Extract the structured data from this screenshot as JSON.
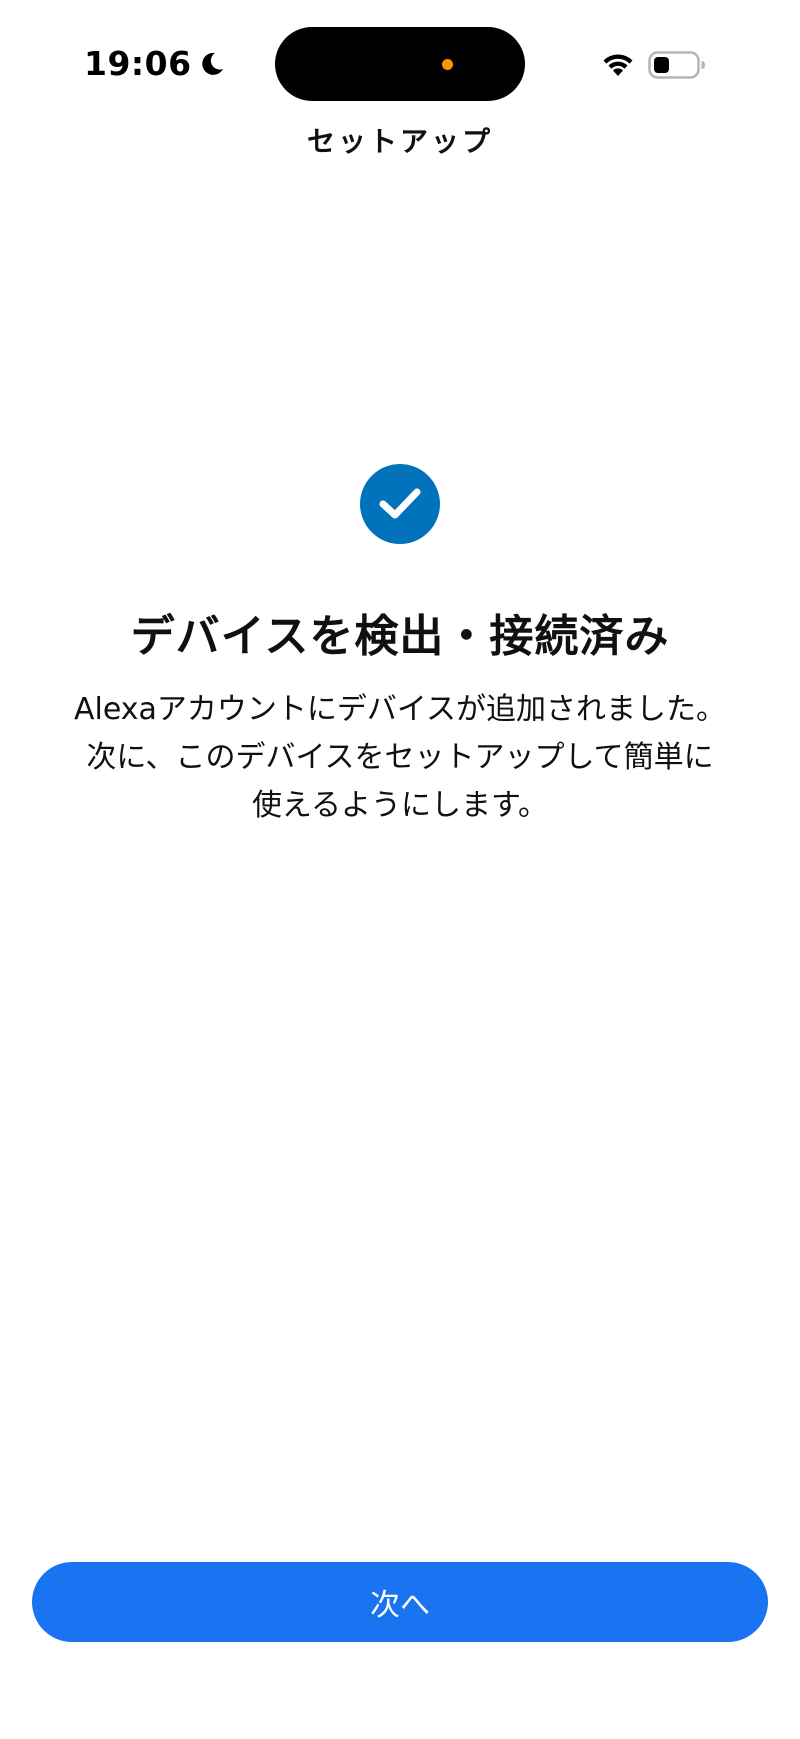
{
  "status_bar": {
    "time": "19:06",
    "icons": [
      "moon-icon",
      "wifi-icon",
      "battery-icon"
    ],
    "island_dot_color": "#ff9500"
  },
  "nav": {
    "title": "セットアップ"
  },
  "content": {
    "icon": "checkmark-circle-icon",
    "icon_color": "#0073bb",
    "heading": "デバイスを検出・接続済み",
    "body_lines": [
      "Alexaアカウントにデバイスが追加されました。",
      "次に、このデバイスをセットアップして簡単に",
      "使えるようにします。"
    ]
  },
  "footer": {
    "next_label": "次へ",
    "button_color": "#1a73f0"
  }
}
